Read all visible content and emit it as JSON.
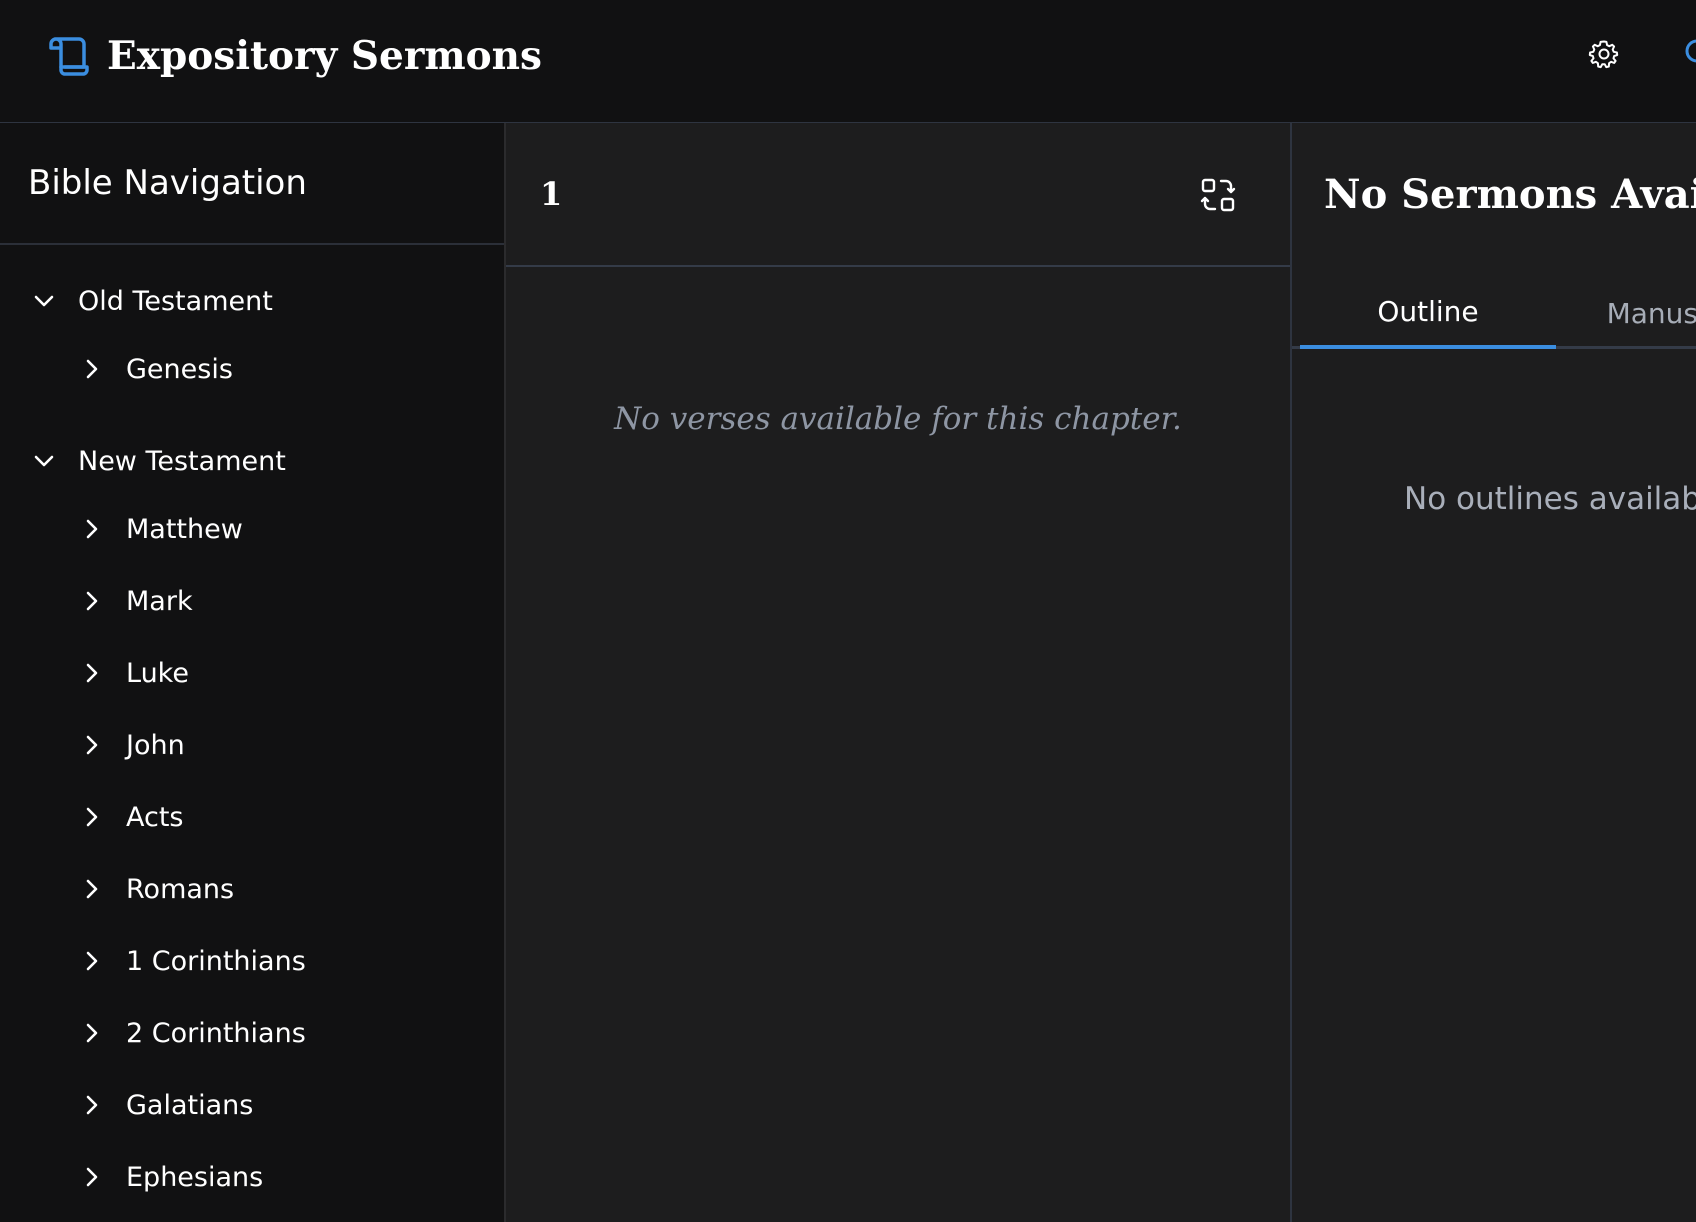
{
  "app": {
    "title": "Expository Sermons",
    "brand_icon": "scroll-icon",
    "accent_color": "#3b8ee0"
  },
  "header": {
    "settings_icon": "gear-icon",
    "search_icon": "search-icon"
  },
  "sidebar": {
    "title": "Bible Navigation",
    "testaments": [
      {
        "label": "Old Testament",
        "expanded": true,
        "books": [
          "Genesis"
        ]
      },
      {
        "label": "New Testament",
        "expanded": true,
        "books": [
          "Matthew",
          "Mark",
          "Luke",
          "John",
          "Acts",
          "Romans",
          "1 Corinthians",
          "2 Corinthians",
          "Galatians",
          "Ephesians"
        ]
      }
    ]
  },
  "reader": {
    "chapter": "1",
    "compare_icon": "compare-icon",
    "empty_message": "No verses available for this chapter."
  },
  "sermons": {
    "title": "No Sermons Available",
    "tabs": [
      {
        "label": "Outline",
        "active": true
      },
      {
        "label": "Manuscript",
        "active": false
      }
    ],
    "empty_message": "No outlines available"
  }
}
